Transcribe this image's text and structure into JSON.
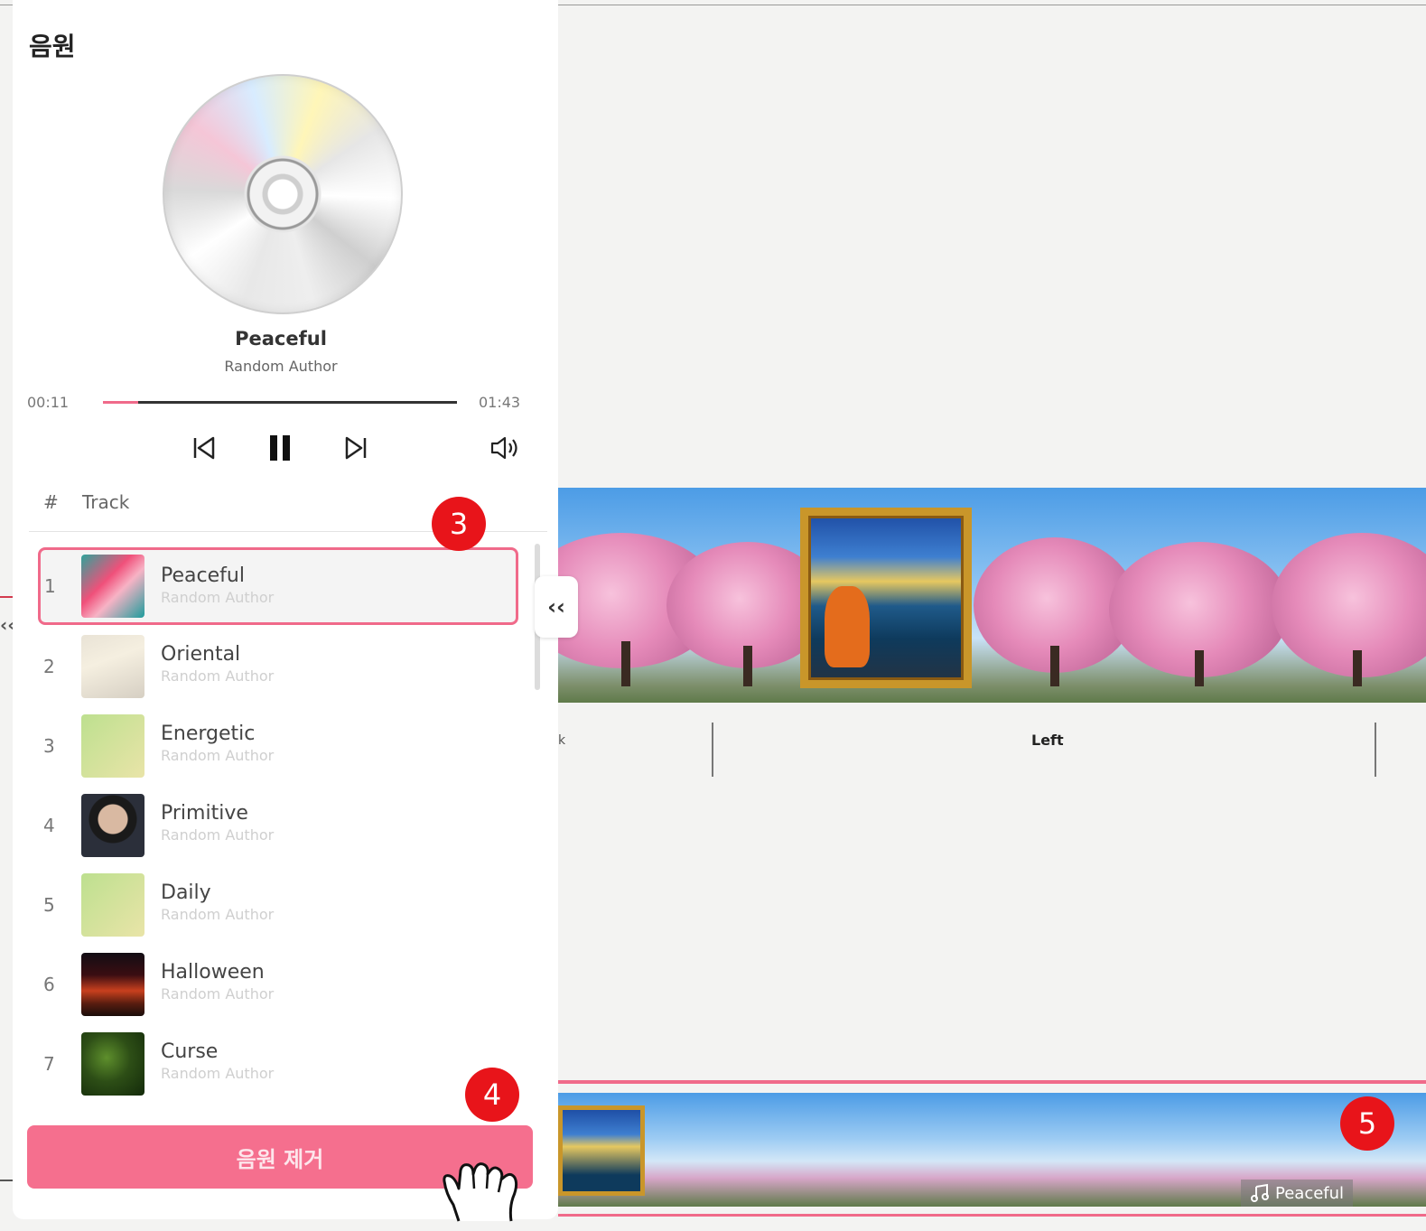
{
  "panel": {
    "title": "음원",
    "now_playing": {
      "title": "Peaceful",
      "author": "Random Author"
    },
    "time_current": "00:11",
    "time_total": "01:43",
    "progress_fraction": 0.1,
    "table_header": {
      "num": "#",
      "track": "Track"
    },
    "tracks": [
      {
        "num": "1",
        "name": "Peaceful",
        "author": "Random Author"
      },
      {
        "num": "2",
        "name": "Oriental",
        "author": "Random Author"
      },
      {
        "num": "3",
        "name": "Energetic",
        "author": "Random Author"
      },
      {
        "num": "4",
        "name": "Primitive",
        "author": "Random Author"
      },
      {
        "num": "5",
        "name": "Daily",
        "author": "Random Author"
      },
      {
        "num": "6",
        "name": "Halloween",
        "author": "Random Author"
      },
      {
        "num": "7",
        "name": "Curse",
        "author": "Random Author"
      }
    ],
    "remove_button": "음원 제거",
    "collapse_symbol": "‹‹"
  },
  "badges": {
    "b3": "3",
    "b4": "4",
    "b5": "5"
  },
  "scene": {
    "label_left": "Left",
    "label_k": "k"
  },
  "timeline": {
    "music_tag": "Peaceful"
  },
  "colors": {
    "accent": "#f06a8a",
    "badge": "#e8141a",
    "button": "#f56f8e"
  },
  "icons": [
    "cd-icon",
    "previous-icon",
    "pause-icon",
    "next-icon",
    "volume-icon",
    "music-note-icon",
    "hand-cursor-icon"
  ]
}
